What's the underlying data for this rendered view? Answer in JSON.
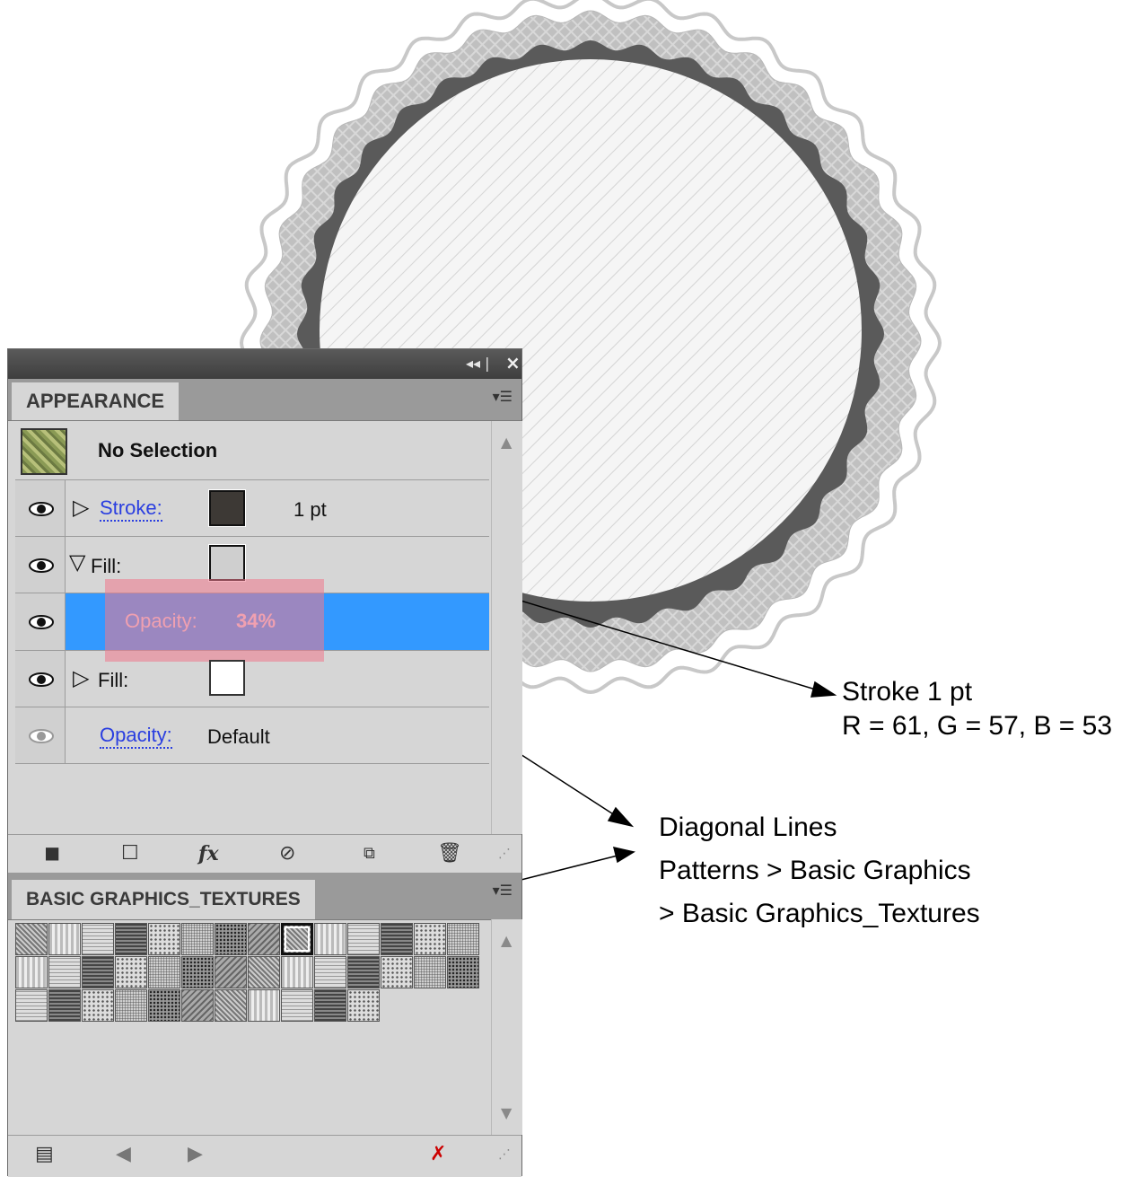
{
  "appearance_panel": {
    "title": "APPEARANCE",
    "selection_label": "No Selection",
    "rows": [
      {
        "name": "Stroke:",
        "value": "1 pt",
        "swatch_color": "#3d3935"
      },
      {
        "name": "Fill:",
        "swatch_color": "#cfcfcf"
      },
      {
        "name": "Opacity:",
        "value": "34%"
      },
      {
        "name": "Fill:",
        "swatch_color": "#ffffff"
      },
      {
        "name": "Opacity:",
        "value": "Default"
      }
    ],
    "highlight_color": "#3399ff",
    "overlay_color": "#f08a9a"
  },
  "swatch_panel": {
    "title": "BASIC GRAPHICS_TEXTURES",
    "swatch_count": 39,
    "selected_swatch": 8
  },
  "annotations": {
    "stroke_line1": "Stroke 1 pt",
    "stroke_line2": "R = 61, G = 57, B = 53",
    "pattern_line1": "Diagonal Lines",
    "pattern_line2": "Patterns > Basic Graphics",
    "pattern_line3": "> Basic Graphics_Textures"
  },
  "colors": {
    "badge_dark": "#595959",
    "badge_scallop": "#bdbdbd",
    "badge_face": "#f4f4f4"
  },
  "icons": [
    "collapse-icon",
    "close-icon",
    "panel-menu-icon",
    "eye-icon",
    "disclosure-triangle-icon",
    "scroll-up-icon",
    "scroll-down-icon",
    "new-art-basic-icon",
    "clear-appearance-icon",
    "fx-icon",
    "no-icon",
    "duplicate-icon",
    "trash-icon",
    "swatch-library-menu-icon",
    "previous-icon",
    "next-icon",
    "break-link-icon",
    "resize-grip-icon"
  ]
}
